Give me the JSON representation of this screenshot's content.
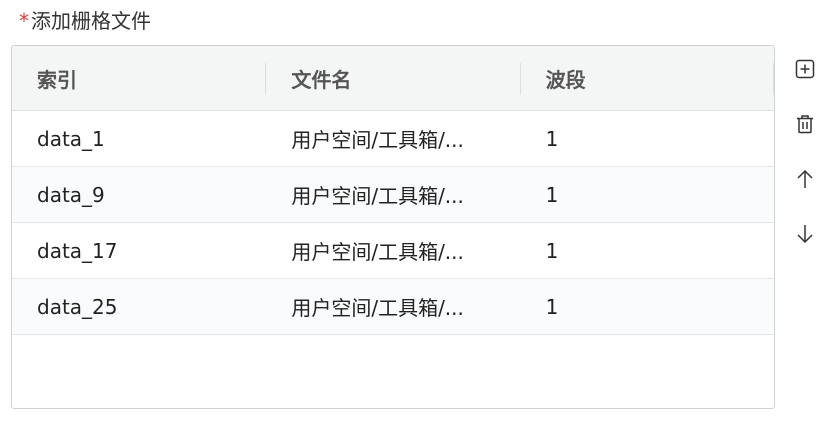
{
  "field": {
    "required_mark": "*",
    "label": "添加栅格文件"
  },
  "table": {
    "columns": [
      "索引",
      "文件名",
      "波段"
    ],
    "rows": [
      {
        "index": "data_1",
        "filename": "用户空间/工具箱/...",
        "band": "1"
      },
      {
        "index": "data_9",
        "filename": "用户空间/工具箱/...",
        "band": "1"
      },
      {
        "index": "data_17",
        "filename": "用户空间/工具箱/...",
        "band": "1"
      },
      {
        "index": "data_25",
        "filename": "用户空间/工具箱/...",
        "band": "1"
      }
    ]
  },
  "actions": [
    "plus-square-icon",
    "trash-icon",
    "arrow-up-icon",
    "arrow-down-icon"
  ],
  "colors": {
    "required": "#e23b3b",
    "header_bg": "#f4f5f5",
    "border": "#cfd3d3"
  }
}
